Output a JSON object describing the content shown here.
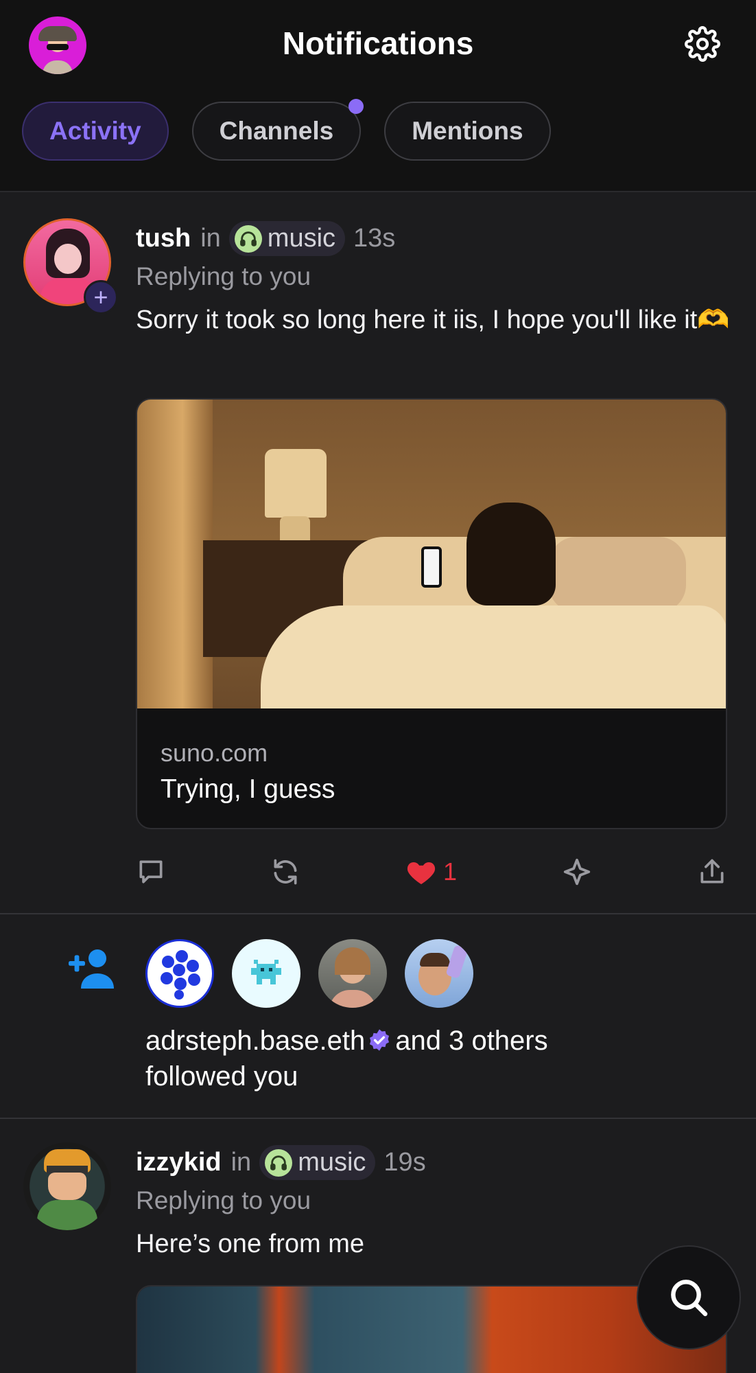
{
  "header": {
    "title": "Notifications",
    "tabs": [
      {
        "label": "Activity",
        "active": true,
        "has_dot": false
      },
      {
        "label": "Channels",
        "active": false,
        "has_dot": true
      },
      {
        "label": "Mentions",
        "active": false,
        "has_dot": false
      }
    ]
  },
  "posts": [
    {
      "username": "tush",
      "in_label": "in",
      "channel": "music",
      "time": "13s",
      "reply_label": "Replying to you",
      "text": "Sorry it took so long here it iis, I hope you'll like it🫶",
      "link": {
        "domain": "suno.com",
        "title": "Trying, I guess"
      },
      "likes": "1"
    },
    {
      "username": "izzykid",
      "in_label": "in",
      "channel": "music",
      "time": "19s",
      "reply_label": "Replying to you",
      "text": "Here’s one from me"
    }
  ],
  "follow_notification": {
    "name": "adrsteph.base.eth",
    "rest": "and 3 others",
    "line2": "followed you"
  },
  "colors": {
    "accent": "#8b72f6",
    "like": "#e8323f",
    "follow_icon": "#1d8ff0",
    "background": "#1c1c1e"
  },
  "icons": [
    "settings-gear-icon",
    "comment-icon",
    "recast-icon",
    "heart-icon",
    "sparkle-icon",
    "share-icon",
    "add-user-icon",
    "verified-badge-icon",
    "search-icon",
    "headphones-icon"
  ]
}
